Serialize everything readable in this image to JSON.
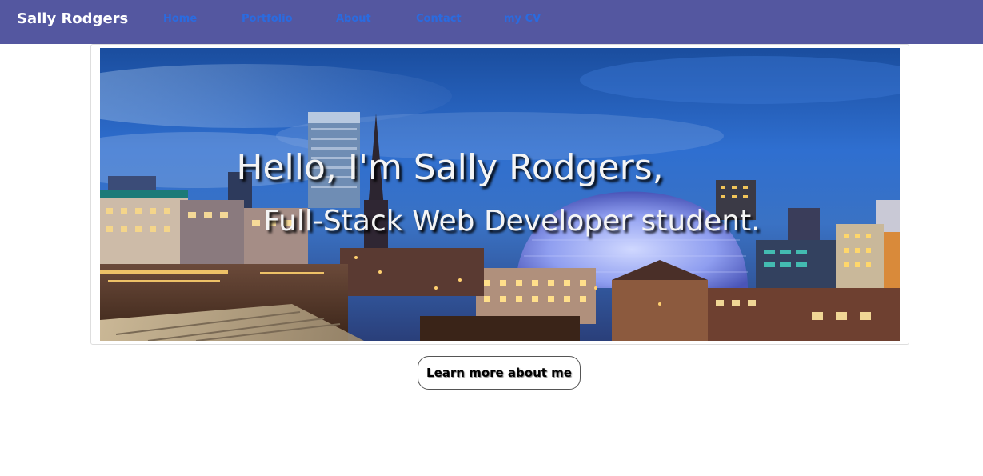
{
  "navbar": {
    "brand": "Sally Rodgers",
    "links": [
      "Home",
      "Portfolio",
      "About",
      "Contact",
      "my CV"
    ]
  },
  "hero": {
    "heading": "Hello, I'm Sally Rodgers,",
    "subheading": "Full-Stack Web Developer student."
  },
  "cta": {
    "label": "Learn more about me"
  },
  "colors": {
    "navbar_bg": "#5457a0",
    "nav_link": "#2a6be0",
    "sky_top": "#1b3f8f",
    "sky_mid": "#2c64c8",
    "dome_glow": "#8fa3f0"
  }
}
